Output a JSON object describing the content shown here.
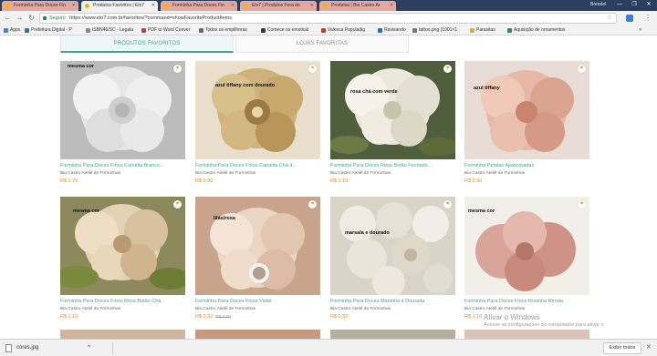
{
  "browser": {
    "tabs": [
      {
        "title": "Forminha Para Doces Fin",
        "active": false
      },
      {
        "title": "Produtos Favoritos | Elo7",
        "active": true
      },
      {
        "title": "Forminha Para Doces Fin",
        "active": false
      },
      {
        "title": "Elo7 | Produtos Fora do",
        "active": false
      },
      {
        "title": "Produtos | Bia Castro Ar",
        "active": false
      }
    ],
    "user": "Brendel",
    "window_controls": {
      "minimize": "—",
      "maximize": "❐",
      "close": "✕"
    },
    "nav": {
      "back": "←",
      "forward": "→",
      "reload": "↻"
    },
    "omnibox": {
      "secure_label": "Seguro",
      "url": "https://www.elo7.com.br/favoritos/?command=showFavoriteProductItems",
      "star": "☆"
    },
    "menu": "⋮",
    "bookmarks": [
      {
        "label": "Apps",
        "color": "#4a7bd4"
      },
      {
        "label": "Prefeitura Digital - P",
        "color": "#2f6fb3"
      },
      {
        "label": "ISBN46/SC - Legala",
        "color": "#888888"
      },
      {
        "label": "PDF to Word Conver",
        "color": "#d9352b"
      },
      {
        "label": "Todos os empilhoras",
        "color": "#6a6a6a"
      },
      {
        "label": "Comece os emotical",
        "color": "#3a3a3a"
      },
      {
        "label": "Valesca Populadig",
        "color": "#c0392b"
      },
      {
        "label": "Revisando",
        "color": "#2b6cb0"
      },
      {
        "label": "tattoo.png (1001×1",
        "color": "#777777"
      },
      {
        "label": "Parasitas",
        "color": "#e0b020"
      },
      {
        "label": "Aquisição de ornamentos",
        "color": "#2e8b57"
      }
    ],
    "bookmarks_more": "»"
  },
  "page": {
    "tabs": [
      {
        "label": "PRODUTOS FAVORITOS",
        "active": true
      },
      {
        "label": "LOJAS FAVORITAS",
        "active": false
      }
    ],
    "heart_icon": "♥",
    "products": [
      {
        "caption": "mesma cor",
        "title": "Forminha Para Doces Finos Camélia Branco...",
        "shop": "Bia Castro Ateliê de Forminhas",
        "price": "R$ 1,70",
        "old_price": ""
      },
      {
        "caption": "azul tiffany com dourado",
        "title": "Forminha Para Doces Finos Camélia Chá d...",
        "shop": "Bia Castro Ateliê de Forminhas",
        "price": "R$ 0,90",
        "old_price": ""
      },
      {
        "caption": "rosa chá com verde",
        "title": "Forminha Para Doces Rosa Botão Fechado...",
        "shop": "Bia Castro Ateliê de Forminhas",
        "price": "R$ 1,10",
        "old_price": ""
      },
      {
        "caption": "azul tiffany",
        "title": "Forminha Pétalas Apaixonadas",
        "shop": "Bia Castro Ateliê de Forminhas",
        "price": "R$ 0,90",
        "old_price": ""
      },
      {
        "caption": "mesma cor",
        "title": "Forminha Para Doces Finos Rosa Botão Chá...",
        "shop": "Bia Castro Ateliê de Forminhas",
        "price": "R$ 1,10",
        "old_price": ""
      },
      {
        "caption": "lilás/rosa",
        "title": "Forminha Para Doces Finos Violet",
        "shop": "Bia Castro Ateliê de Forminhas",
        "price": "R$ 0,32",
        "old_price": "R$ 0,80"
      },
      {
        "caption": "marsala e dourado",
        "title": "Forminha Para Doces Maninha e Dourada",
        "shop": "Bia Castro Ateliê de Forminhas",
        "price": "R$ 0,32",
        "old_price": ""
      },
      {
        "caption": "mesma cor",
        "title": "Forminha Para Doces Finos Rosinha Renda",
        "shop": "Bia Castro Ateliê de Forminhas",
        "price": "R$ 1,10",
        "old_price": ""
      }
    ]
  },
  "watermark": {
    "heading": "Ativar o Windows",
    "subtext": "Acesse as configurações do computador para ativar o"
  },
  "downloads": {
    "file_name": "cores.jpg",
    "caret": "^",
    "show_all": "Exibir todos",
    "close": "✕"
  }
}
